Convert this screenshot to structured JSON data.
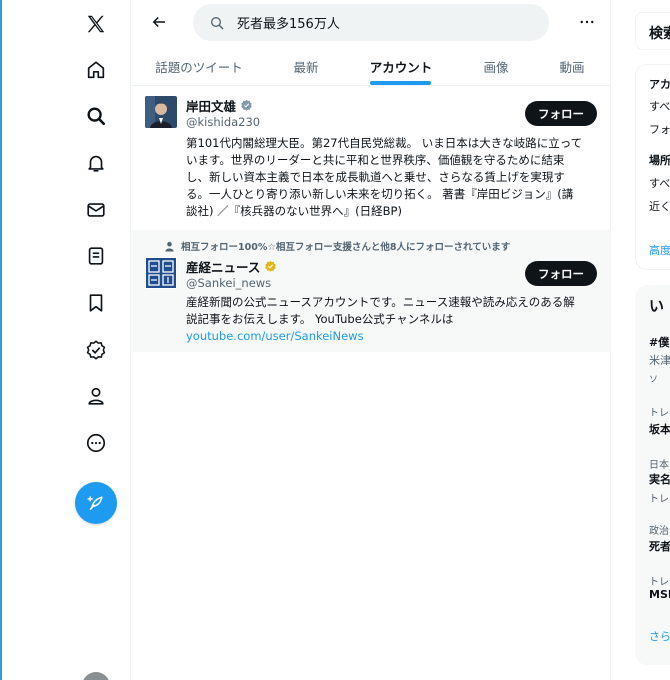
{
  "search": {
    "query": "死者最多156万人"
  },
  "tabs": [
    {
      "label": "話題のツイート"
    },
    {
      "label": "最新"
    },
    {
      "label": "アカウント"
    },
    {
      "label": "画像"
    },
    {
      "label": "動画"
    }
  ],
  "accounts": [
    {
      "name": "岸田文雄",
      "handle": "@kishida230",
      "follow_label": "フォロー",
      "bio_lines": [
        "第101代内閣総理大臣。第27代自民党総裁。 いま日本は大きな岐路に立って",
        "います。世界のリーダーと共に平和と世界秩序、価値観を守るために結束",
        "し、新しい資本主義で日本を成長軌道へと乗せ、さらなる賃上げを実現す",
        "る。一人ひとり寄り添い新しい未来を切り拓く。 著書『岸田ビジョン』(講",
        "談社) ／『核兵器のない世界へ』(日経BP)"
      ]
    },
    {
      "social_context": "相互フォロー100%☆相互フォロー支援さんと他8人にフォローされています",
      "name": "産経ニュース",
      "handle": "@Sankei_news",
      "follow_label": "フォロー",
      "bio_lines": [
        "産経新聞の公式ニュースアカウントです。ニュース速報や読み応えのある解",
        "説記事をお伝えします。 YouTube公式チャンネルは"
      ],
      "link": "youtube.com/user/SankeiNews"
    }
  ],
  "right": {
    "search_title": "検索",
    "filter_items": [
      "アカ",
      "すべ",
      "フォ",
      "場所",
      "すべ",
      "近く",
      "高度"
    ],
    "trends_title": "い",
    "trend_items": [
      "#僕",
      "米津",
      "ソ",
      "トレ",
      "坂本",
      "日本",
      "実名",
      "トレ",
      "政治",
      "死者",
      "トレ",
      "MSI",
      "さら"
    ]
  }
}
